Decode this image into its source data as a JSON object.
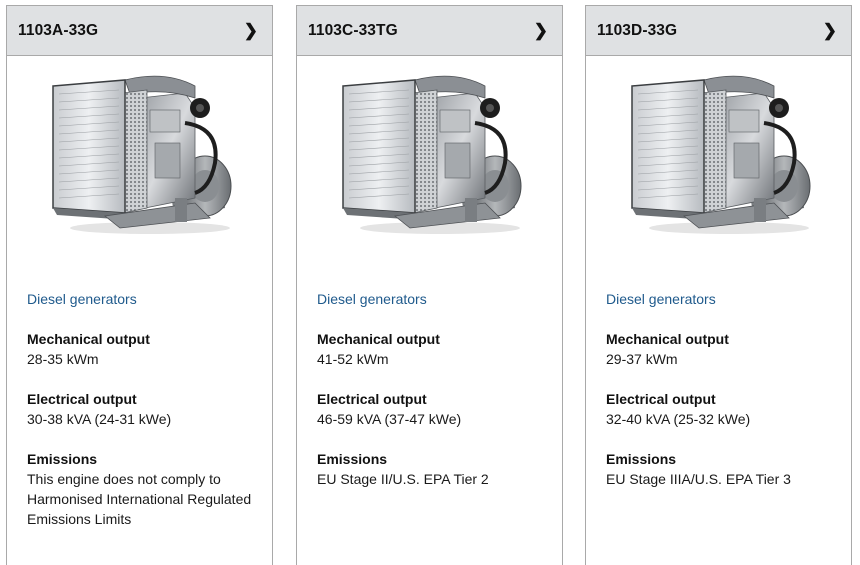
{
  "cards": [
    {
      "title": "1103A-33G",
      "category": "Diesel generators",
      "mechanical_label": "Mechanical output",
      "mechanical_value": "28-35 kWm",
      "electrical_label": "Electrical output",
      "electrical_value": "30-38 kVA (24-31 kWe)",
      "emissions_label": "Emissions",
      "emissions_value": "This engine does not comply to Harmonised International Regulated Emissions Limits",
      "chevron_icon": "chevron-right-icon"
    },
    {
      "title": "1103C-33TG",
      "category": "Diesel generators",
      "mechanical_label": "Mechanical output",
      "mechanical_value": "41-52 kWm",
      "electrical_label": "Electrical output",
      "electrical_value": "46-59 kVA (37-47 kWe)",
      "emissions_label": "Emissions",
      "emissions_value": "EU Stage II/U.S. EPA Tier 2",
      "chevron_icon": "chevron-right-icon"
    },
    {
      "title": "1103D-33G",
      "category": "Diesel generators",
      "mechanical_label": "Mechanical output",
      "mechanical_value": "29-37 kWm",
      "electrical_label": "Electrical output",
      "electrical_value": "32-40 kVA (25-32 kWe)",
      "emissions_label": "Emissions",
      "emissions_value": "EU Stage IIIA/U.S. EPA Tier 3",
      "chevron_icon": "chevron-right-icon"
    }
  ],
  "colors": {
    "header_bg": "#dfe1e3",
    "border": "#a9a9a9",
    "link": "#1f5a8c"
  }
}
